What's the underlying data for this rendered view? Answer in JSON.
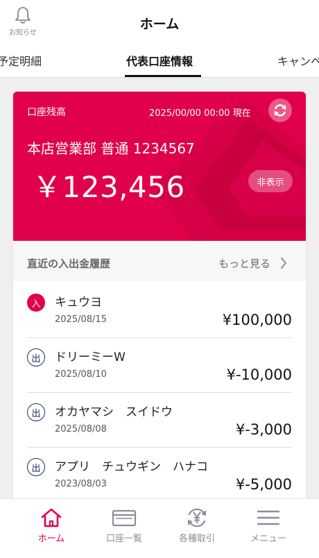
{
  "header": {
    "notify_label": "お知らせ",
    "title": "ホーム"
  },
  "tabs": [
    {
      "label": "予定明細"
    },
    {
      "label": "代表口座情報"
    },
    {
      "label": "キャンペ"
    }
  ],
  "balance": {
    "label": "口座残高",
    "timestamp": "2025/00/00 00:00  現在",
    "account": "本店営業部 普通 1234567",
    "amount": "￥123,456",
    "hide_label": "非表示"
  },
  "history": {
    "title": "直近の入出金履歴",
    "more_label": "もっと見る",
    "items": [
      {
        "type": "入",
        "kind": "in",
        "name": "キュウヨ",
        "date": "2025/08/15",
        "amount": "¥100,000"
      },
      {
        "type": "出",
        "kind": "out",
        "name": "ドリーミーW",
        "date": "2025/08/10",
        "amount": "¥-10,000"
      },
      {
        "type": "出",
        "kind": "out",
        "name": "オカヤマシ　スイドウ",
        "date": "2025/08/08",
        "amount": "¥-3,000"
      },
      {
        "type": "出",
        "kind": "out",
        "name": "アプリ　チュウギン　ハナコ",
        "date": "2023/08/03",
        "amount": "¥-5,000"
      }
    ]
  },
  "nav": [
    {
      "label": "ホーム",
      "icon": "home-icon",
      "active": true
    },
    {
      "label": "口座一覧",
      "icon": "card-icon",
      "active": false
    },
    {
      "label": "各種取引",
      "icon": "yen-exchange-icon",
      "active": false
    },
    {
      "label": "メニュー",
      "icon": "menu-icon",
      "active": false
    }
  ],
  "colors": {
    "brand": "#e0004b",
    "navy": "#1e2e5c"
  }
}
